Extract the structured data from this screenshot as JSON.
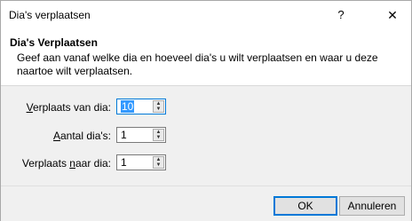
{
  "window": {
    "title": "Dia's verplaatsen",
    "help_label": "?",
    "close_label": "✕"
  },
  "header": {
    "title": "Dia's Verplaatsen",
    "description": "Geef aan vanaf welke dia en hoeveel dia's u wilt verplaatsen en waar u deze naartoe wilt verplaatsen."
  },
  "form": {
    "from_slide": {
      "label_accel": "V",
      "label_rest": "erplaats van dia:",
      "value": "10"
    },
    "count": {
      "label_accel": "A",
      "label_rest": "antal dia's:",
      "value": "1"
    },
    "to_slide": {
      "label_pre": "Verplaats ",
      "label_accel": "n",
      "label_rest": "aar dia:",
      "value": "1"
    }
  },
  "buttons": {
    "ok_label": "OK",
    "cancel_label": "Annuleren"
  }
}
